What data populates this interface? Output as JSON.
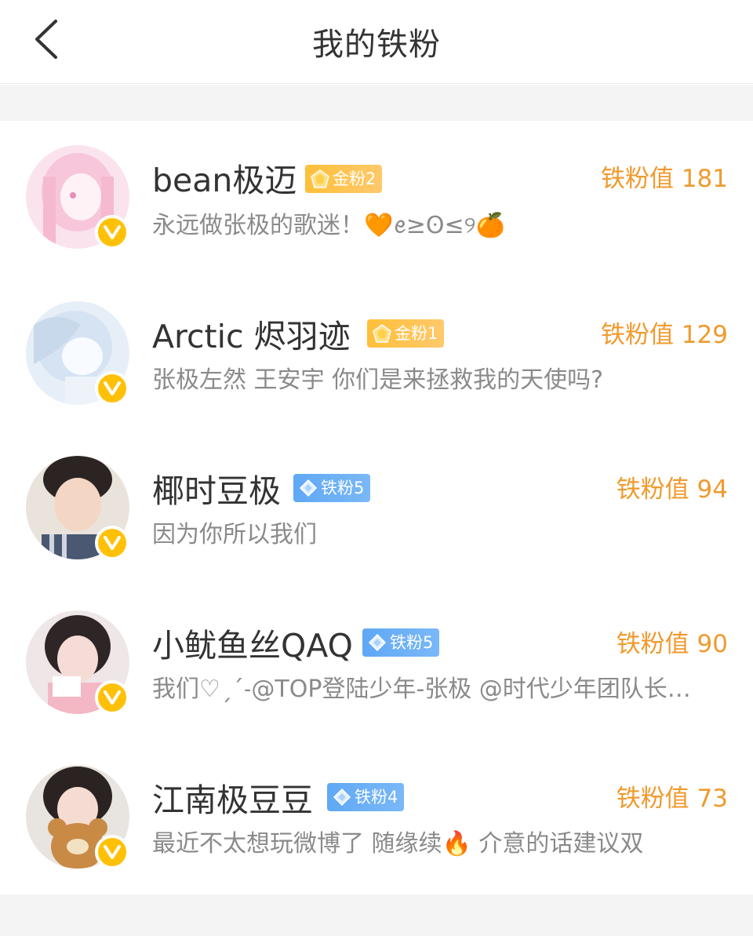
{
  "header": {
    "title": "我的铁粉",
    "back_icon": "chevron-left-icon"
  },
  "colors": {
    "score": "#f09a2e",
    "gold_badge": "#ffbf3a",
    "blue_badge": "#5fa8f5",
    "verified": "#ffc107",
    "name": "#333333",
    "bio": "#8a8a8a"
  },
  "fans": [
    {
      "name": "bean极迈",
      "badge": "金粉2",
      "badge_type": "gold",
      "score": "铁粉值 181",
      "bio": "永远做张极的歌迷！🧡ꫀ≥ʘ≤୨🍊",
      "verified_icon": "v-badge-icon"
    },
    {
      "name": "Arctic  烬羽迹",
      "badge": "金粉1",
      "badge_type": "gold",
      "score": "铁粉值 129",
      "bio": "张极左然 王安宇 你们是来拯救我的天使吗?",
      "verified_icon": "v-badge-icon"
    },
    {
      "name": "椰时豆极",
      "badge": "铁粉5",
      "badge_type": "blue",
      "score": "铁粉值 94",
      "bio": "因为你所以我们",
      "verified_icon": "v-badge-icon"
    },
    {
      "name": "小鱿鱼丝QAQ",
      "badge": "铁粉5",
      "badge_type": "blue",
      "score": "铁粉值 90",
      "bio": "我们♡ˏˊ˗@TOP登陆少年-张极 @时代少年团队长…",
      "verified_icon": "v-badge-icon"
    },
    {
      "name": "江南极豆豆",
      "badge": "铁粉4",
      "badge_type": "blue",
      "score": "铁粉值 73",
      "bio": "最近不太想玩微博了 随缘续🔥 介意的话建议双",
      "verified_icon": "v-badge-icon"
    }
  ]
}
